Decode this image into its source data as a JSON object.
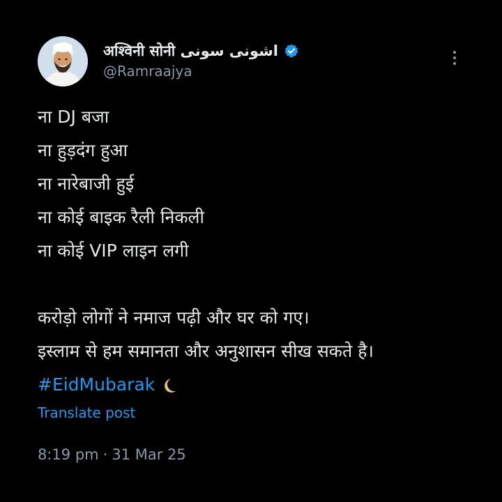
{
  "post": {
    "author": {
      "display_name": "अश्विनी सोनी اشونی سونی",
      "handle": "@Ramraajya",
      "verified_icon": "verified-badge-icon",
      "avatar": "avatar"
    },
    "more_icon": "more-options-icon",
    "lines": [
      "ना DJ बजा",
      "ना हुड़दंग हुआ",
      "ना नारेबाजी हुई",
      "ना कोई बाइक रैली निकली",
      "ना कोई VIP लाइन लगी",
      "",
      "करोड़ो लोगों ने नमाज पढ़ी और घर को गए।",
      "इस्लाम से हम समानता और अनुशासन सीख सकते है।"
    ],
    "hashtag": "#EidMubarak",
    "hashtag_icon": "crescent-moon-icon",
    "translate_label": "Translate post",
    "time": "8:19 pm",
    "separator": "·",
    "date": "31 Mar 25"
  },
  "colors": {
    "background": "#000000",
    "text": "#e7e9ea",
    "secondary": "#8b98a5",
    "accent": "#1d9bf0"
  }
}
